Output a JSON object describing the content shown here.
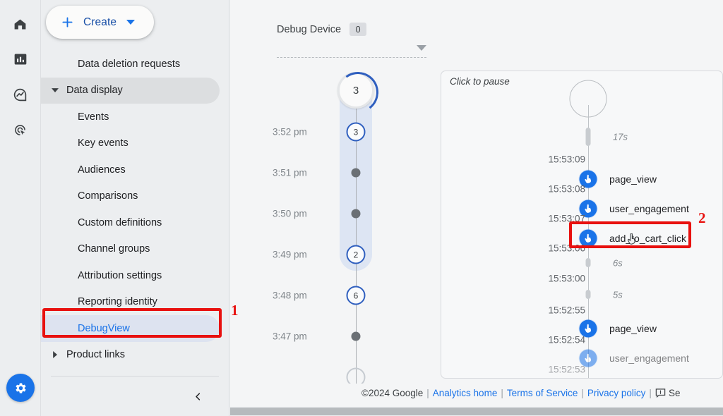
{
  "rail": {
    "items": [
      {
        "name": "home-icon",
        "label": "Home"
      },
      {
        "name": "reports-icon",
        "label": "Reports"
      },
      {
        "name": "explore-icon",
        "label": "Explore"
      },
      {
        "name": "advertising-icon",
        "label": "Advertising"
      }
    ],
    "settings_label": "Admin"
  },
  "sidebar": {
    "create_label": "Create",
    "items": [
      {
        "label": "Data deletion requests",
        "type": "child",
        "state": "normal"
      },
      {
        "label": "Data display",
        "type": "group",
        "state": "active-group",
        "expanded": true
      },
      {
        "label": "Events",
        "type": "child",
        "state": "normal"
      },
      {
        "label": "Key events",
        "type": "child",
        "state": "normal"
      },
      {
        "label": "Audiences",
        "type": "child",
        "state": "normal"
      },
      {
        "label": "Comparisons",
        "type": "child",
        "state": "normal"
      },
      {
        "label": "Custom definitions",
        "type": "child",
        "state": "normal"
      },
      {
        "label": "Channel groups",
        "type": "child",
        "state": "normal"
      },
      {
        "label": "Attribution settings",
        "type": "child",
        "state": "normal"
      },
      {
        "label": "Reporting identity",
        "type": "child",
        "state": "normal"
      },
      {
        "label": "DebugView",
        "type": "child",
        "state": "selected"
      },
      {
        "label": "Product links",
        "type": "group",
        "state": "normal",
        "expanded": false
      }
    ]
  },
  "debug_device": {
    "title": "Debug Device",
    "count": "0",
    "timeline": [
      {
        "label": "",
        "value": "3",
        "node": "big"
      },
      {
        "label": "3:52 pm",
        "value": "3",
        "node": "ring"
      },
      {
        "label": "3:51 pm",
        "value": "",
        "node": "dot"
      },
      {
        "label": "3:50 pm",
        "value": "",
        "node": "dot"
      },
      {
        "label": "3:49 pm",
        "value": "2",
        "node": "ring"
      },
      {
        "label": "3:48 pm",
        "value": "6",
        "node": "ring"
      },
      {
        "label": "3:47 pm",
        "value": "",
        "node": "dot"
      },
      {
        "label": "",
        "value": "",
        "node": "partial"
      }
    ]
  },
  "events_stream": {
    "pause_hint": "Click to pause",
    "rows": [
      {
        "kind": "gap",
        "label": "17s",
        "time": ""
      },
      {
        "kind": "event",
        "label": "page_view",
        "time": "15:53:09"
      },
      {
        "kind": "event",
        "label": "user_engagement",
        "time": "15:53:08"
      },
      {
        "kind": "event",
        "label": "add_to_cart_click",
        "time": "15:53:07",
        "highlighted": true
      },
      {
        "kind": "time",
        "label": "",
        "time": "15:53:06"
      },
      {
        "kind": "gap",
        "label": "6s",
        "time": ""
      },
      {
        "kind": "time",
        "label": "",
        "time": "15:53:00"
      },
      {
        "kind": "gap",
        "label": "5s",
        "time": ""
      },
      {
        "kind": "time",
        "label": "",
        "time": "15:52:55"
      },
      {
        "kind": "event",
        "label": "page_view",
        "time": "15:52:54"
      },
      {
        "kind": "event",
        "label": "user_engagement",
        "time": "15:52:53",
        "faded": true
      }
    ]
  },
  "annotations": [
    {
      "number": "1",
      "target": "DebugView"
    },
    {
      "number": "2",
      "target": "add_to_cart_click"
    }
  ],
  "footer": {
    "copyright": "©2024 Google",
    "links": [
      "Analytics home",
      "Terms of Service",
      "Privacy policy"
    ],
    "feedback_label": "Se"
  },
  "colors": {
    "accent_blue": "#1a73e8",
    "annotation_red": "#e8110f",
    "selected_bg": "#dde3f0",
    "panel_bg": "#f4f5f6"
  }
}
